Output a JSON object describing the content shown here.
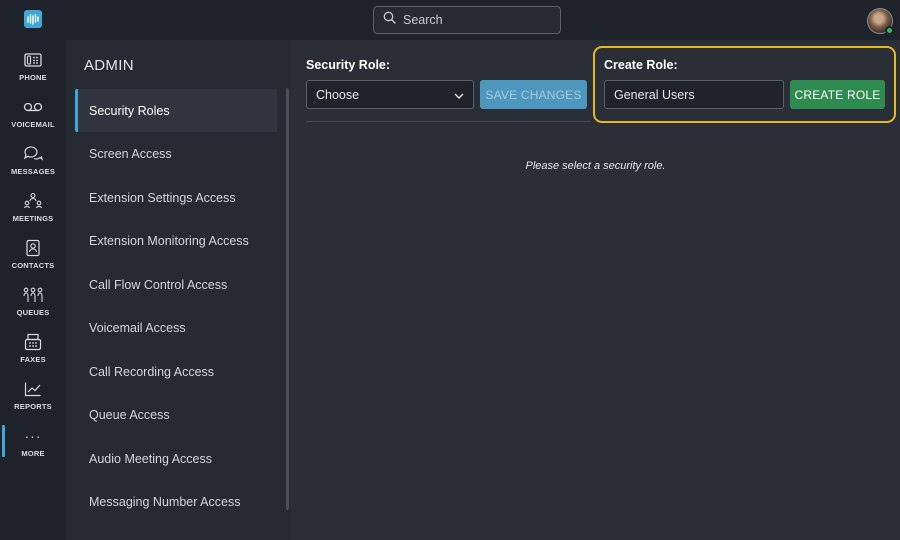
{
  "search": {
    "placeholder": "Search"
  },
  "rail": {
    "items": [
      {
        "label": "PHONE",
        "icon": "phone-icon"
      },
      {
        "label": "VOICEMAIL",
        "icon": "voicemail-icon"
      },
      {
        "label": "MESSAGES",
        "icon": "messages-icon"
      },
      {
        "label": "MEETINGS",
        "icon": "meetings-icon"
      },
      {
        "label": "CONTACTS",
        "icon": "contacts-icon"
      },
      {
        "label": "QUEUES",
        "icon": "queues-icon"
      },
      {
        "label": "FAXES",
        "icon": "fax-icon"
      },
      {
        "label": "REPORTS",
        "icon": "reports-icon"
      },
      {
        "label": "MORE",
        "icon": "more-icon",
        "glyph": "···"
      }
    ],
    "active": "MORE"
  },
  "admin": {
    "title": "ADMIN",
    "items": [
      {
        "label": "Security Roles"
      },
      {
        "label": "Screen Access"
      },
      {
        "label": "Extension Settings Access"
      },
      {
        "label": "Extension Monitoring Access"
      },
      {
        "label": "Call Flow Control Access"
      },
      {
        "label": "Voicemail Access"
      },
      {
        "label": "Call Recording Access"
      },
      {
        "label": "Queue Access"
      },
      {
        "label": "Audio Meeting Access"
      },
      {
        "label": "Messaging Number Access"
      }
    ],
    "active_index": 0
  },
  "main": {
    "security_role_label": "Security Role:",
    "security_role_value": "Choose",
    "save_label": "SAVE CHANGES",
    "create_role_label": "Create Role:",
    "create_role_value": "General Users",
    "create_button_label": "CREATE ROLE",
    "empty_message": "Please select a security role."
  },
  "colors": {
    "accent": "#3fa7d9",
    "highlight_border": "#e8b820",
    "create_button": "#2e8b4f",
    "save_button": "#4d97bf"
  }
}
